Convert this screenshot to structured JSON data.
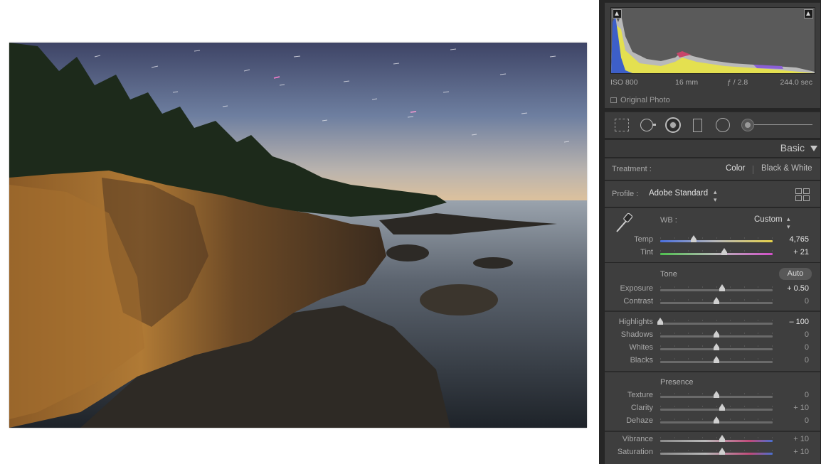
{
  "histogram": {
    "exif": {
      "iso": "ISO 800",
      "focal_length": "16 mm",
      "aperture": "ƒ / 2.8",
      "shutter": "244.0 sec"
    },
    "original_photo_label": "Original Photo"
  },
  "tools": [
    "crop-overlay",
    "spot-removal",
    "red-eye",
    "graduated-filter",
    "radial-filter",
    "adjustment-brush"
  ],
  "panel": {
    "title": "Basic",
    "treatment": {
      "label": "Treatment :",
      "color": "Color",
      "bw": "Black & White",
      "selected": "Color"
    },
    "profile": {
      "label": "Profile :",
      "value": "Adobe Standard"
    },
    "wb": {
      "label": "WB :",
      "value": "Custom"
    },
    "wb_sliders": [
      {
        "label": "Temp",
        "value": "4,765",
        "pos": 0.3,
        "changed": true,
        "gradient": "temp"
      },
      {
        "label": "Tint",
        "value": "+ 21",
        "pos": 0.57,
        "changed": true,
        "gradient": "tint"
      }
    ],
    "tone": {
      "title": "Tone",
      "auto": "Auto",
      "sliders": [
        {
          "label": "Exposure",
          "value": "+ 0.50",
          "pos": 0.55,
          "changed": true
        },
        {
          "label": "Contrast",
          "value": "0",
          "pos": 0.5,
          "changed": false
        }
      ]
    },
    "highlights_group": [
      {
        "label": "Highlights",
        "value": "– 100",
        "pos": 0.0,
        "changed": true
      },
      {
        "label": "Shadows",
        "value": "0",
        "pos": 0.5,
        "changed": false
      },
      {
        "label": "Whites",
        "value": "0",
        "pos": 0.5,
        "changed": false
      },
      {
        "label": "Blacks",
        "value": "0",
        "pos": 0.5,
        "changed": false
      }
    ],
    "presence": {
      "title": "Presence",
      "sliders": [
        {
          "label": "Texture",
          "value": "0",
          "pos": 0.5,
          "changed": false
        },
        {
          "label": "Clarity",
          "value": "+ 10",
          "pos": 0.55,
          "changed": false
        },
        {
          "label": "Dehaze",
          "value": "0",
          "pos": 0.5,
          "changed": false
        }
      ]
    },
    "color_group": [
      {
        "label": "Vibrance",
        "value": "+ 10",
        "pos": 0.55,
        "changed": false,
        "gradient": "vib"
      },
      {
        "label": "Saturation",
        "value": "+ 10",
        "pos": 0.55,
        "changed": false,
        "gradient": "sat"
      }
    ]
  },
  "colors": {
    "panel_bg": "#3e3e3e",
    "frame_bg": "#262626",
    "accent_text": "#e2e2e2"
  }
}
